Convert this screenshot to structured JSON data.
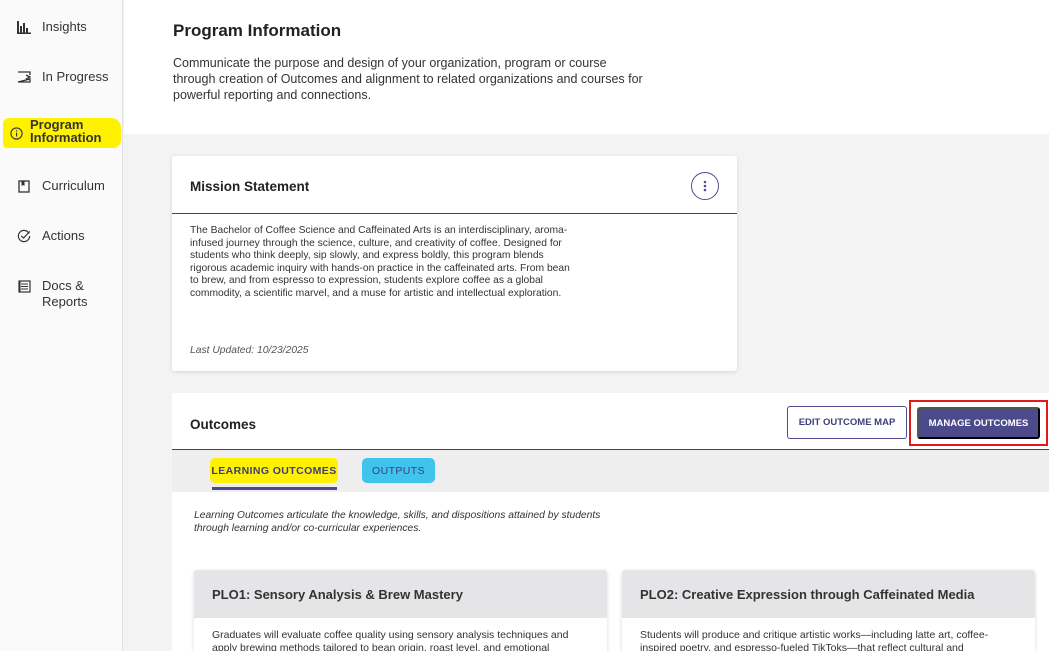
{
  "sidebar": {
    "items": [
      {
        "label": "Insights",
        "icon": "bar-chart-icon"
      },
      {
        "label": "In Progress",
        "icon": "ticket-icon"
      },
      {
        "label": "Program Information",
        "icon": "info-icon",
        "active": true
      },
      {
        "label": "Curriculum",
        "icon": "bookmark-icon"
      },
      {
        "label": "Actions",
        "icon": "check-circle-icon"
      },
      {
        "label": "Docs & Reports",
        "icon": "document-icon"
      }
    ]
  },
  "header": {
    "title": "Program Information",
    "description": "Communicate the purpose and design of your organization, program or course through creation of Outcomes and alignment to related organizations and courses for powerful reporting and connections."
  },
  "mission": {
    "title": "Mission Statement",
    "text": "The Bachelor of Coffee Science and Caffeinated Arts is an interdisciplinary, aroma-infused journey through the science, culture, and creativity of coffee. Designed for students who think deeply, sip slowly, and express boldly, this program blends rigorous academic inquiry with hands-on practice in the caffeinated arts. From bean to brew, and from espresso to expression, students explore coffee as a global commodity, a scientific marvel, and a muse for artistic and intellectual exploration.",
    "last_updated": "Last Updated: 10/23/2025"
  },
  "outcomes": {
    "title": "Outcomes",
    "edit_label": "EDIT OUTCOME MAP",
    "manage_label": "MANAGE OUTCOMES",
    "tabs": [
      {
        "label": "LEARNING OUTCOMES",
        "active": true
      },
      {
        "label": "OUTPUTS",
        "active": false
      }
    ],
    "description": "Learning Outcomes articulate the knowledge, skills, and dispositions attained by students through learning and/or co-curricular experiences.",
    "cards": [
      {
        "title": "PLO1: Sensory Analysis & Brew Mastery",
        "body": "Graduates will evaluate coffee quality using sensory analysis techniques and apply brewing methods tailored to bean origin, roast level, and emotional"
      },
      {
        "title": "PLO2: Creative Expression through Caffeinated Media",
        "body": "Students will produce and critique artistic works—including latte art, coffee-inspired poetry, and espresso-fueled TikToks—that reflect cultural and"
      }
    ]
  },
  "colors": {
    "accent": "#4b4a8c",
    "highlight_yellow": "#fff200",
    "highlight_cyan": "#3fc4ee",
    "callout_red": "#e3191c"
  }
}
